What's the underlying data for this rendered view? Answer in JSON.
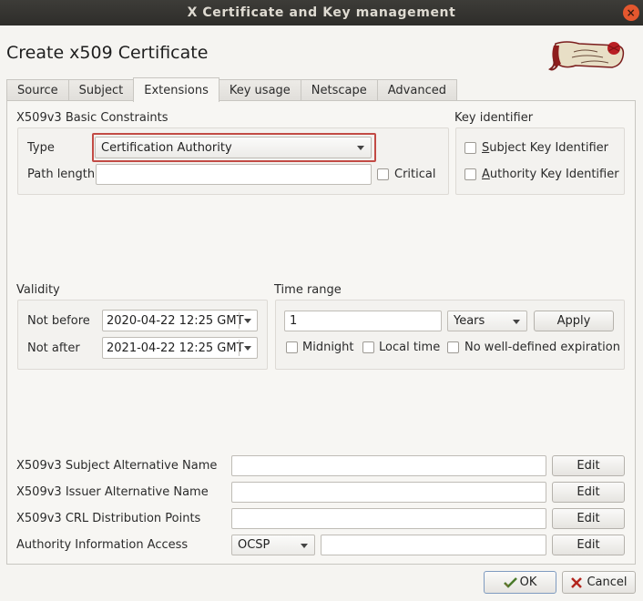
{
  "window": {
    "title": "X Certificate and Key management"
  },
  "heading": "Create x509 Certificate",
  "tabs": [
    "Source",
    "Subject",
    "Extensions",
    "Key usage",
    "Netscape",
    "Advanced"
  ],
  "basic_constraints": {
    "title": "X509v3 Basic Constraints",
    "type_label": "Type",
    "type_value": "Certification Authority",
    "path_length_label": "Path length",
    "path_length_value": "",
    "critical_label": "Critical"
  },
  "key_identifier": {
    "title": "Key identifier",
    "subject": {
      "first": "S",
      "rest": "ubject Key Identifier"
    },
    "authority": {
      "first": "A",
      "rest": "uthority Key Identifier"
    }
  },
  "validity": {
    "title": "Validity",
    "not_before_label": "Not before",
    "not_before_value": "2020-04-22 12:25 GMT",
    "not_after_label": "Not after",
    "not_after_value": "2021-04-22 12:25 GMT"
  },
  "time_range": {
    "title": "Time range",
    "amount": "1",
    "unit": "Years",
    "apply_label": "Apply",
    "midnight_label": "Midnight",
    "local_time_label": "Local time",
    "no_expiration_label": "No well-defined expiration"
  },
  "extensions": {
    "san_label": "X509v3 Subject Alternative Name",
    "ian_label": "X509v3 Issuer Alternative Name",
    "crl_label": "X509v3 CRL Distribution Points",
    "aia_label": "Authority Information Access",
    "aia_method": "OCSP",
    "edit_label": "Edit"
  },
  "footer": {
    "ok_label": "OK",
    "cancel_label": "Cancel"
  }
}
